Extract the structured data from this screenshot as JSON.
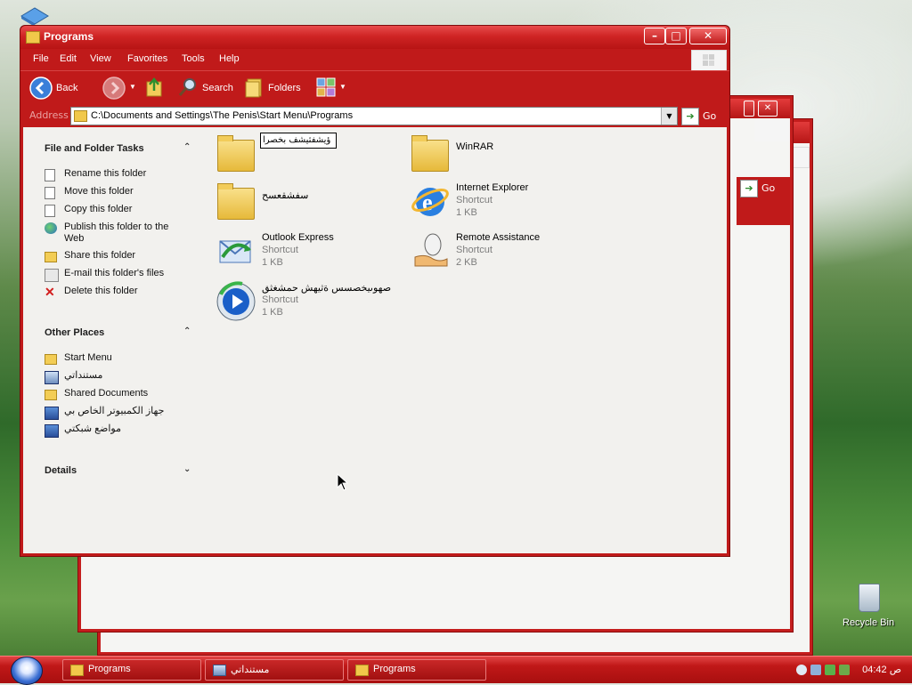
{
  "desktop": {
    "recycle_bin_label": "Recycle Bin"
  },
  "main_window": {
    "title": "Programs",
    "menu": [
      "File",
      "Edit",
      "View",
      "Favorites",
      "Tools",
      "Help"
    ],
    "toolbar": {
      "back_label": "Back",
      "search_label": "Search",
      "folders_label": "Folders"
    },
    "address": {
      "label": "Address",
      "value": "C:\\Documents and Settings\\The Penis\\Start Menu\\Programs",
      "go_label": "Go"
    },
    "file_folder_tasks": {
      "title": "File and Folder Tasks",
      "items": [
        {
          "label": "Rename this folder",
          "icon": "rename-icon"
        },
        {
          "label": "Move this folder",
          "icon": "move-icon"
        },
        {
          "label": "Copy this folder",
          "icon": "copy-icon"
        },
        {
          "label": "Publish this folder to the Web",
          "icon": "publish-web-icon"
        },
        {
          "label": "Share this folder",
          "icon": "share-icon"
        },
        {
          "label": "E-mail this folder's files",
          "icon": "email-icon"
        },
        {
          "label": "Delete this folder",
          "icon": "delete-icon"
        }
      ]
    },
    "other_places": {
      "title": "Other Places",
      "items": [
        {
          "label": "Start Menu",
          "icon": "folder-icon"
        },
        {
          "label": "مستنداتي",
          "icon": "my-documents-icon"
        },
        {
          "label": "Shared Documents",
          "icon": "folder-icon"
        },
        {
          "label": "جهاز الكمبيوتر الخاص بي",
          "icon": "my-computer-icon"
        },
        {
          "label": "مواضع شبكتي",
          "icon": "network-places-icon"
        }
      ]
    },
    "details": {
      "title": "Details"
    },
    "files": [
      {
        "name": "ؤيشفثيشف بخصرا",
        "type": "",
        "size": "",
        "icon": "folder-icon",
        "renaming": true
      },
      {
        "name": "WinRAR",
        "type": "",
        "size": "",
        "icon": "folder-icon"
      },
      {
        "name": "سفشقعسح",
        "type": "",
        "size": "",
        "icon": "folder-icon"
      },
      {
        "name": "Internet Explorer",
        "type": "Shortcut",
        "size": "1 KB",
        "icon": "internet-explorer-icon"
      },
      {
        "name": "Outlook Express",
        "type": "Shortcut",
        "size": "1 KB",
        "icon": "outlook-express-icon"
      },
      {
        "name": "Remote Assistance",
        "type": "Shortcut",
        "size": "2 KB",
        "icon": "remote-assistance-icon"
      },
      {
        "name": "صهوىيخصسس ةثيهش حمشغثق",
        "type": "Shortcut",
        "size": "1 KB",
        "icon": "media-player-icon"
      }
    ]
  },
  "background_window": {
    "go_label": "Go"
  },
  "taskbar": {
    "tasks": [
      {
        "label": "Programs"
      },
      {
        "label": "مستنداتي"
      },
      {
        "label": "Programs"
      }
    ],
    "clock": "04:42 ص"
  },
  "colors": {
    "frame_red": "#c01a1a",
    "titlebar_red": "#d62a2a",
    "client_bg": "#f2f1ee"
  }
}
